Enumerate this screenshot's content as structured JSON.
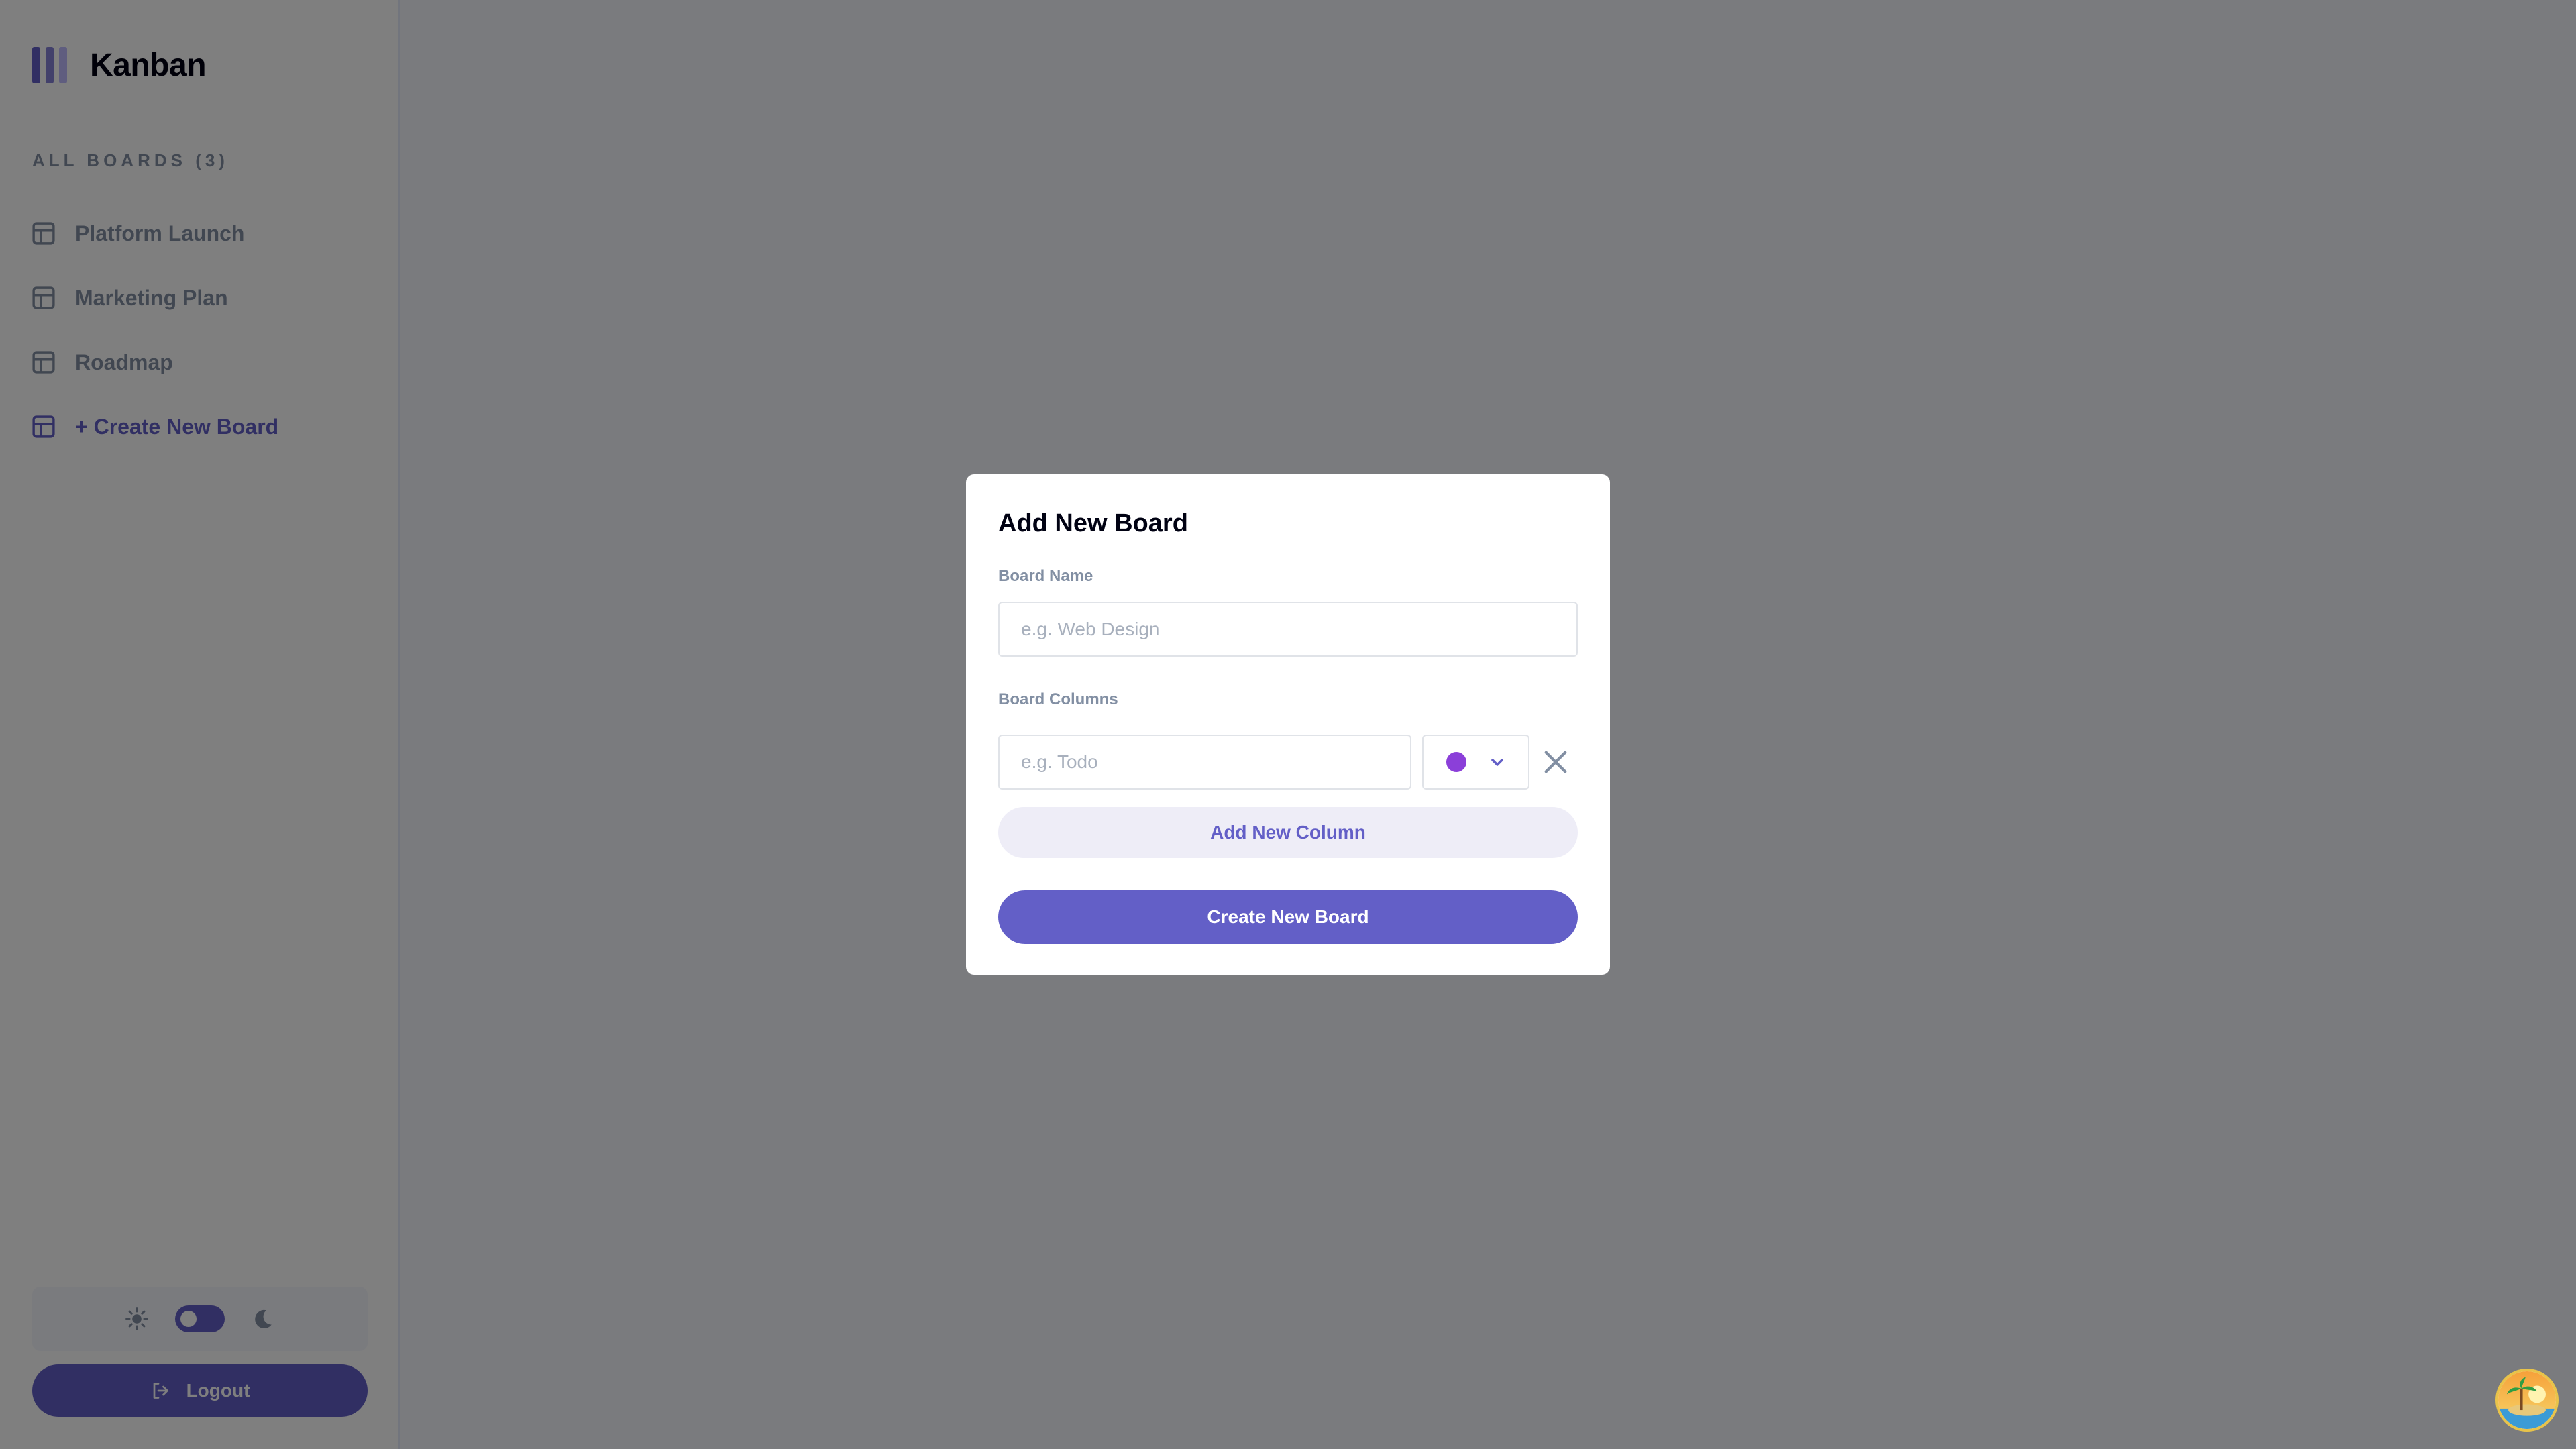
{
  "app": {
    "name": "Kanban",
    "logo_colors": [
      "#635fc7",
      "#6f6bd0",
      "#a8a4ff"
    ]
  },
  "sidebar": {
    "heading": "ALL BOARDS (3)",
    "items": [
      {
        "label": "Platform Launch",
        "icon": "board-icon"
      },
      {
        "label": "Marketing Plan",
        "icon": "board-icon"
      },
      {
        "label": "Roadmap",
        "icon": "board-icon"
      }
    ],
    "create_label": "+ Create New Board",
    "theme": {
      "light_icon": "sun-icon",
      "dark_icon": "moon-icon",
      "toggle_state": "light"
    },
    "logout_label": "Logout"
  },
  "modal": {
    "title": "Add New Board",
    "board_name_label": "Board Name",
    "board_name_value": "",
    "board_name_placeholder": "e.g. Web Design",
    "columns_label": "Board Columns",
    "columns": [
      {
        "value": "",
        "placeholder": "e.g. Todo",
        "color": "#8b3fd9"
      }
    ],
    "add_column_label": "Add New Column",
    "submit_label": "Create New Board"
  },
  "colors": {
    "accent": "#635fc7",
    "overlay": "rgba(0,0,0,0.5)"
  }
}
